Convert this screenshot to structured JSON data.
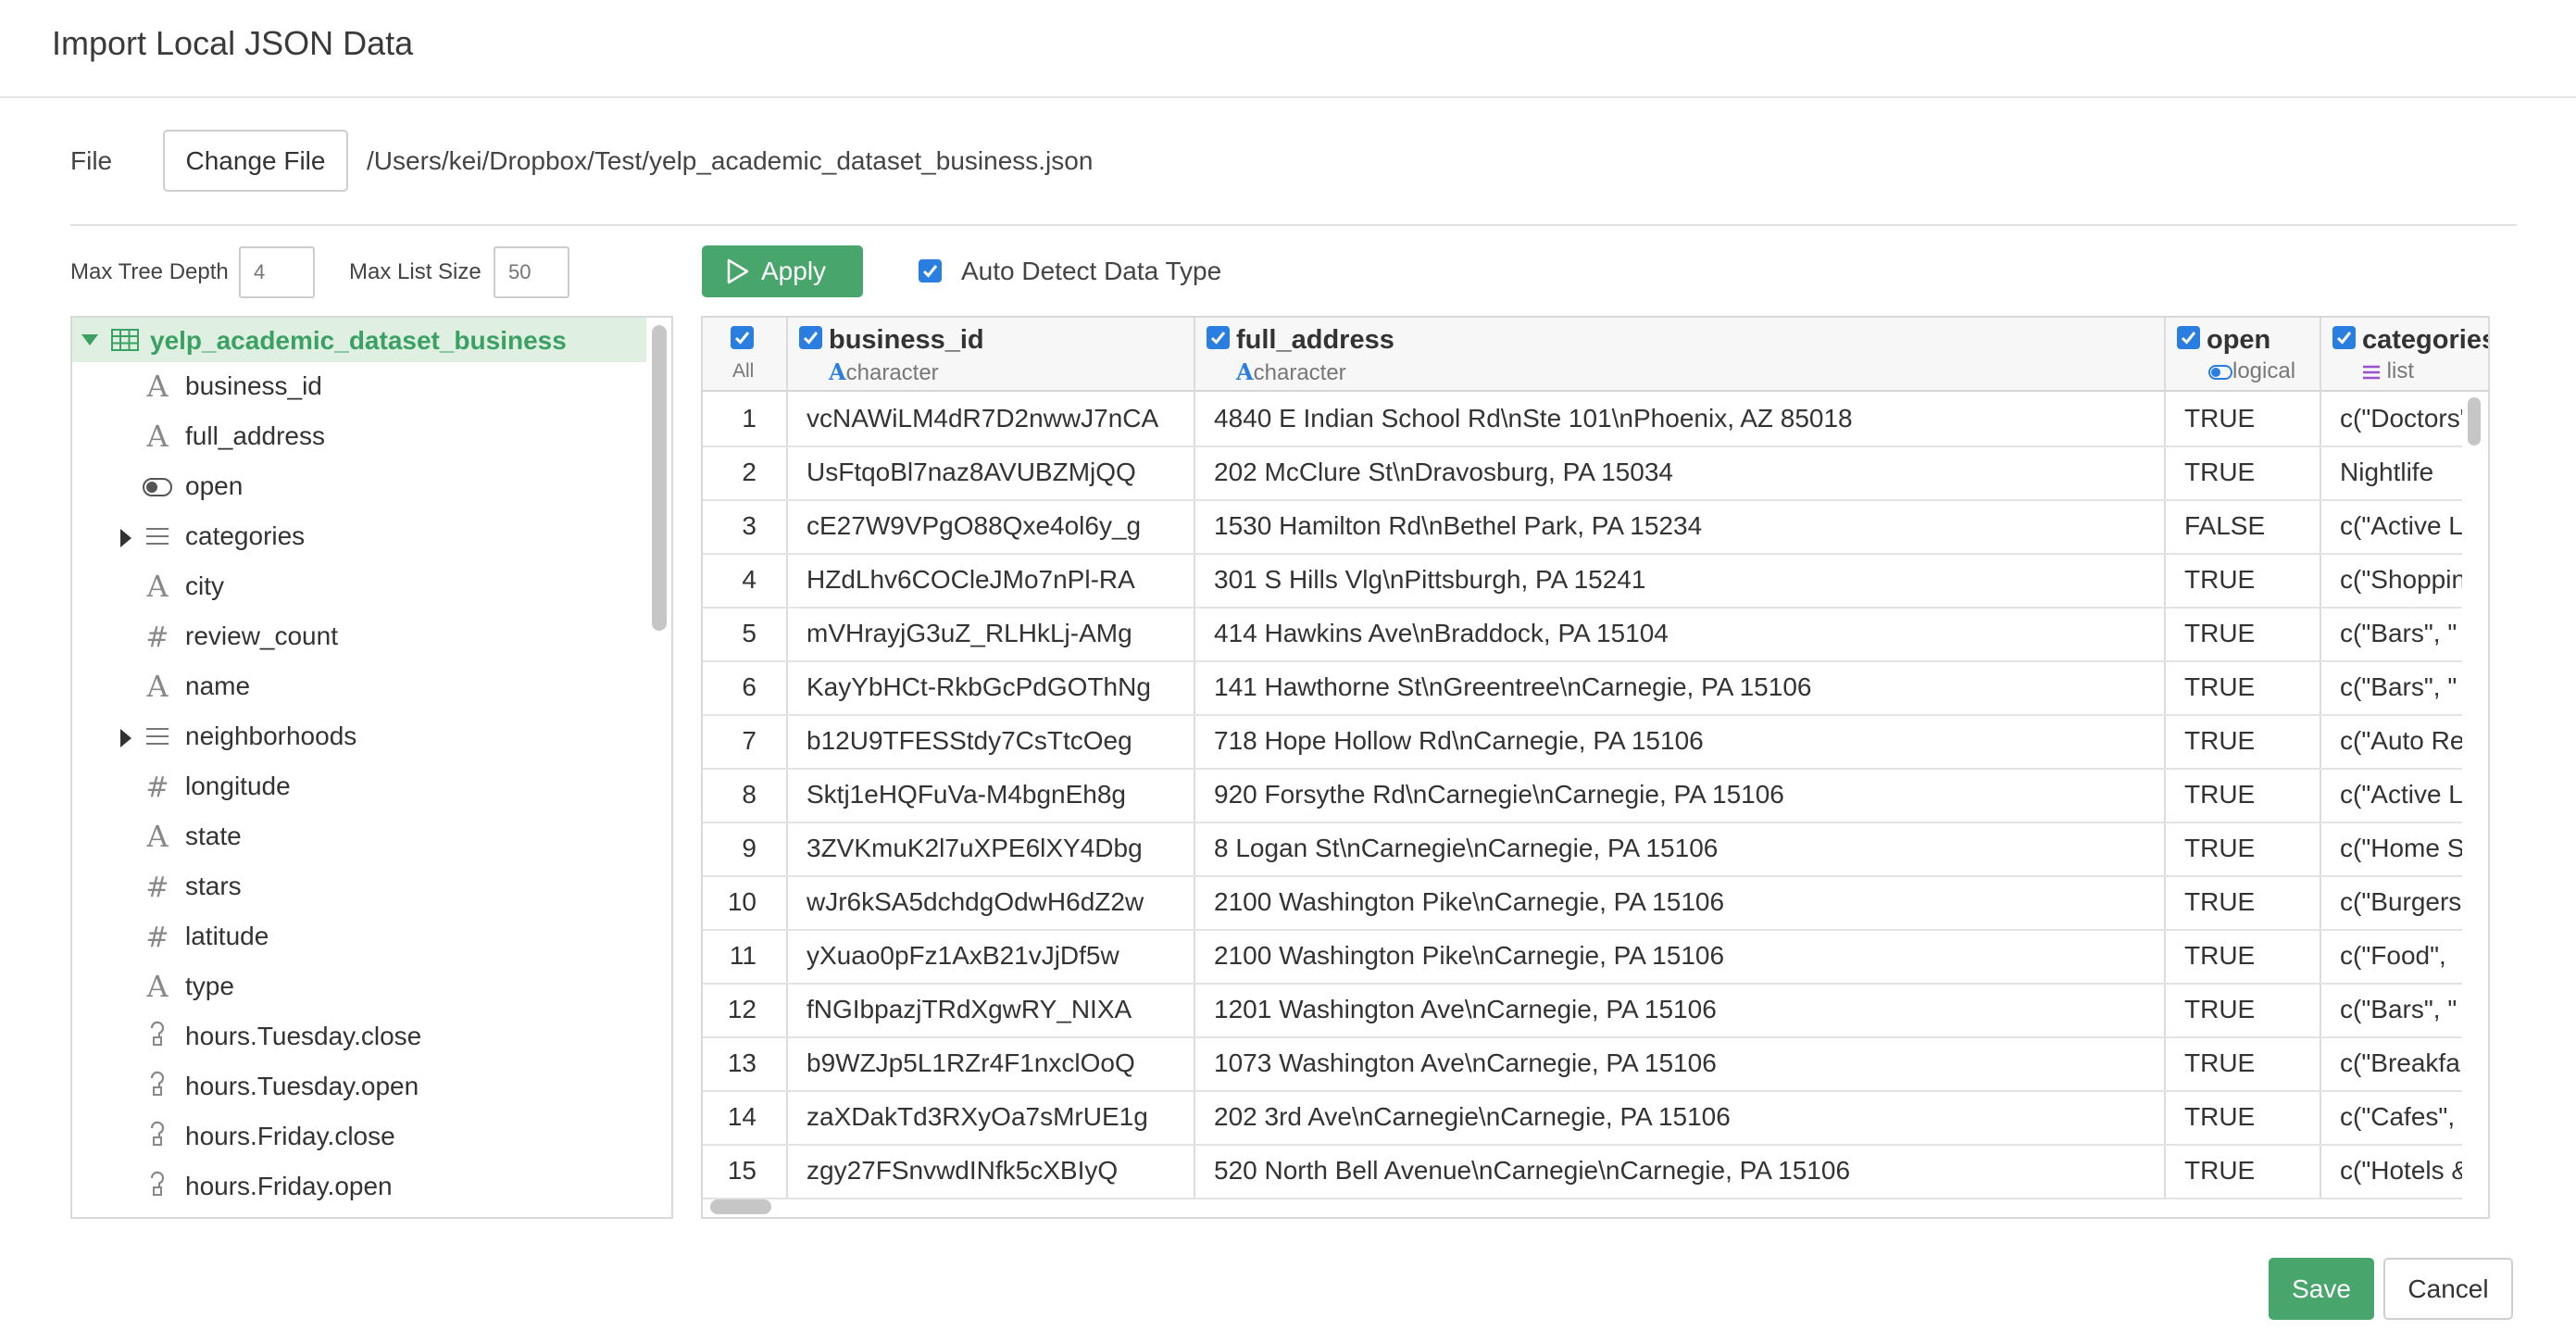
{
  "dialog": {
    "title": "Import Local JSON Data"
  },
  "file": {
    "label": "File",
    "change_button": "Change File",
    "path": "/Users/kei/Dropbox/Test/yelp_academic_dataset_business.json"
  },
  "options": {
    "max_tree_depth_label": "Max Tree Depth",
    "max_tree_depth_placeholder": "4",
    "max_list_size_label": "Max List Size",
    "max_list_size_placeholder": "50",
    "apply_label": "Apply",
    "auto_detect_label": "Auto Detect Data Type",
    "auto_detect_checked": true
  },
  "tree": {
    "root": "yelp_academic_dataset_business",
    "items": [
      {
        "label": "business_id",
        "icon": "character-icon"
      },
      {
        "label": "full_address",
        "icon": "character-icon"
      },
      {
        "label": "open",
        "icon": "logical-icon"
      },
      {
        "label": "categories",
        "icon": "list-icon",
        "expandable": true
      },
      {
        "label": "city",
        "icon": "character-icon"
      },
      {
        "label": "review_count",
        "icon": "numeric-icon"
      },
      {
        "label": "name",
        "icon": "character-icon"
      },
      {
        "label": "neighborhoods",
        "icon": "list-icon",
        "expandable": true
      },
      {
        "label": "longitude",
        "icon": "numeric-icon"
      },
      {
        "label": "state",
        "icon": "character-icon"
      },
      {
        "label": "stars",
        "icon": "numeric-icon"
      },
      {
        "label": "latitude",
        "icon": "numeric-icon"
      },
      {
        "label": "type",
        "icon": "character-icon"
      },
      {
        "label": "hours.Tuesday.close",
        "icon": "unknown-type-icon"
      },
      {
        "label": "hours.Tuesday.open",
        "icon": "unknown-type-icon"
      },
      {
        "label": "hours.Friday.close",
        "icon": "unknown-type-icon"
      },
      {
        "label": "hours.Friday.open",
        "icon": "unknown-type-icon"
      }
    ]
  },
  "table": {
    "all_label": "All",
    "columns": [
      {
        "name": "business_id",
        "type": "character"
      },
      {
        "name": "full_address",
        "type": "character"
      },
      {
        "name": "open",
        "type": "logical"
      },
      {
        "name": "categories",
        "type": "list"
      }
    ],
    "rows": [
      [
        "1",
        "vcNAWiLM4dR7D2nwwJ7nCA",
        "4840 E Indian School Rd\\nSte 101\\nPhoenix, AZ 85018",
        "TRUE",
        "c(\"Doctors\""
      ],
      [
        "2",
        "UsFtqoBl7naz8AVUBZMjQQ",
        "202 McClure St\\nDravosburg, PA 15034",
        "TRUE",
        "Nightlife"
      ],
      [
        "3",
        "cE27W9VPgO88Qxe4ol6y_g",
        "1530 Hamilton Rd\\nBethel Park, PA 15234",
        "FALSE",
        "c(\"Active L"
      ],
      [
        "4",
        "HZdLhv6COCleJMo7nPl-RA",
        "301 S Hills Vlg\\nPittsburgh, PA 15241",
        "TRUE",
        "c(\"Shoppin"
      ],
      [
        "5",
        "mVHrayjG3uZ_RLHkLj-AMg",
        "414 Hawkins Ave\\nBraddock, PA 15104",
        "TRUE",
        "c(\"Bars\", \""
      ],
      [
        "6",
        "KayYbHCt-RkbGcPdGOThNg",
        "141 Hawthorne St\\nGreentree\\nCarnegie, PA 15106",
        "TRUE",
        "c(\"Bars\", \""
      ],
      [
        "7",
        "b12U9TFESStdy7CsTtcOeg",
        "718 Hope Hollow Rd\\nCarnegie, PA 15106",
        "TRUE",
        "c(\"Auto Re"
      ],
      [
        "8",
        "Sktj1eHQFuVa-M4bgnEh8g",
        "920 Forsythe Rd\\nCarnegie\\nCarnegie, PA 15106",
        "TRUE",
        "c(\"Active L"
      ],
      [
        "9",
        "3ZVKmuK2l7uXPE6lXY4Dbg",
        "8 Logan St\\nCarnegie\\nCarnegie, PA 15106",
        "TRUE",
        "c(\"Home S"
      ],
      [
        "10",
        "wJr6kSA5dchdgOdwH6dZ2w",
        "2100 Washington Pike\\nCarnegie, PA 15106",
        "TRUE",
        "c(\"Burgers"
      ],
      [
        "11",
        "yXuao0pFz1AxB21vJjDf5w",
        "2100 Washington Pike\\nCarnegie, PA 15106",
        "TRUE",
        "c(\"Food\", "
      ],
      [
        "12",
        "fNGIbpazjTRdXgwRY_NIXA",
        "1201 Washington Ave\\nCarnegie, PA 15106",
        "TRUE",
        "c(\"Bars\", \""
      ],
      [
        "13",
        "b9WZJp5L1RZr4F1nxclOoQ",
        "1073 Washington Ave\\nCarnegie, PA 15106",
        "TRUE",
        "c(\"Breakfa"
      ],
      [
        "14",
        "zaXDakTd3RXyOa7sMrUE1g",
        "202 3rd Ave\\nCarnegie\\nCarnegie, PA 15106",
        "TRUE",
        "c(\"Cafes\", "
      ],
      [
        "15",
        "zgy27FSnvwdINfk5cXBIyQ",
        "520 North Bell Avenue\\nCarnegie\\nCarnegie, PA 15106",
        "TRUE",
        "c(\"Hotels &"
      ]
    ]
  },
  "footer": {
    "save_label": "Save",
    "cancel_label": "Cancel"
  },
  "colors": {
    "accent_green": "#48a56b",
    "checkbox_blue": "#2a7ee0",
    "tree_selected_bg": "#dff0e3"
  }
}
